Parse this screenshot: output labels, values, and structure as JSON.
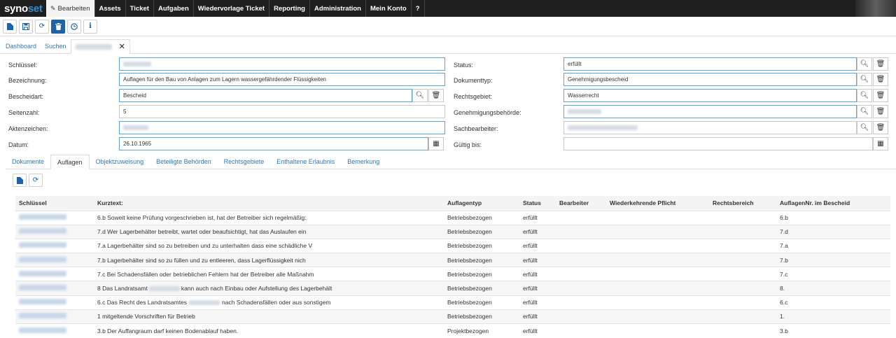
{
  "brand": {
    "part1": "syno",
    "part2": "set"
  },
  "nav": {
    "items": [
      "Bearbeiten",
      "Assets",
      "Ticket",
      "Aufgaben",
      "Wiedervorlage Ticket",
      "Reporting",
      "Administration",
      "Mein Konto",
      "?"
    ],
    "active_index": 0
  },
  "toolbar": {
    "buttons": [
      "new-file-icon",
      "save-icon",
      "refresh-icon",
      "delete-icon",
      "history-icon",
      "info-icon"
    ]
  },
  "pagetabs": {
    "dashboard": "Dashboard",
    "search": "Suchen"
  },
  "form": {
    "schluessel_label": "Schlüssel:",
    "bezeichnung_label": "Bezeichnung:",
    "bezeichnung_value": "Auflagen für den Bau von Anlagen zum Lagern wassergefährdender Flüssigkeiten",
    "bescheidart_label": "Bescheidart:",
    "bescheidart_value": "Bescheid",
    "seitenzahl_label": "Seitenzahl:",
    "seitenzahl_value": "5",
    "aktenzeichen_label": "Aktenzeichen:",
    "datum_label": "Datum:",
    "datum_value": "26.10.1965",
    "status_label": "Status:",
    "status_value": "erfüllt",
    "dokumenttyp_label": "Dokumenttyp:",
    "dokumenttyp_value": "Genehmigungsbescheid",
    "rechtsgebiet_label": "Rechtsgebiet:",
    "rechtsgebiet_value": "Wasserrecht",
    "behoerde_label": "Genehmigungsbehörde:",
    "sachbearbeiter_label": "Sachbearbeiter:",
    "gueltig_label": "Gültig bis:"
  },
  "subtabs": {
    "items": [
      "Dokumente",
      "Auflagen",
      "Objektzuweisung",
      "Beteiligte Behörden",
      "Rechtsgebiete",
      "Enthaltene Erlaubnis",
      "Bemerkung"
    ],
    "active_index": 1
  },
  "table": {
    "columns": [
      "Schlüssel",
      "Kurztext:",
      "Auflagentyp",
      "Status",
      "Bearbeiter",
      "Wiederkehrende Pflicht",
      "Rechtsbereich",
      "AuflagenNr. im Bescheid"
    ],
    "rows": [
      {
        "kurztext": "6.b Soweit keine Prüfung vorgeschrieben ist, hat der Betreiber sich regelmäßig:",
        "typ": "Betriebsbezogen",
        "status": "erfüllt",
        "nr": "6.b"
      },
      {
        "kurztext": "7.d Wer Lagerbehälter betreibt, wartet oder beaufsichtigt, hat das Auslaufen ein",
        "typ": "Betriebsbezogen",
        "status": "erfüllt",
        "nr": "7.d"
      },
      {
        "kurztext": "7.a Lagerbehälter sind so zu betreiben und zu unterhalten dass eine schädliche V",
        "typ": "Betriebsbezogen",
        "status": "erfüllt",
        "nr": "7.a"
      },
      {
        "kurztext": "7.b Lagerbehälter sind so zu füllen und zu entleeren, dass Lagerflüssigkeit nich",
        "typ": "Betriebsbezogen",
        "status": "erfüllt",
        "nr": "7.b"
      },
      {
        "kurztext": "7.c Bei Schadensfällen oder betrieblichen Fehlern hat der Betreiber alle Maßnahm",
        "typ": "Betriebsbezogen",
        "status": "erfüllt",
        "nr": "7.c"
      },
      {
        "kurztext_a": "8 Das Landratsamt",
        "kurztext_b": "kann auch nach Einbau oder Aufstellung des Lagerbehält",
        "typ": "Betriebsbezogen",
        "status": "erfüllt",
        "nr": "8."
      },
      {
        "kurztext_a": "6.c Das Recht des Landratsamtes",
        "kurztext_b": "nach Schadensfällen oder aus sonstigem",
        "typ": "Betriebsbezogen",
        "status": "erfüllt",
        "nr": "6.c"
      },
      {
        "kurztext": "1 mitgeltende Vorschriften für Betrieb",
        "typ": "Betriebsbezogen",
        "status": "erfüllt",
        "nr": "1."
      },
      {
        "kurztext": "3.b Der Auffangraum darf keinen Bodenablauf haben.",
        "typ": "Projektbezogen",
        "status": "erfüllt",
        "nr": "3.b"
      }
    ]
  }
}
